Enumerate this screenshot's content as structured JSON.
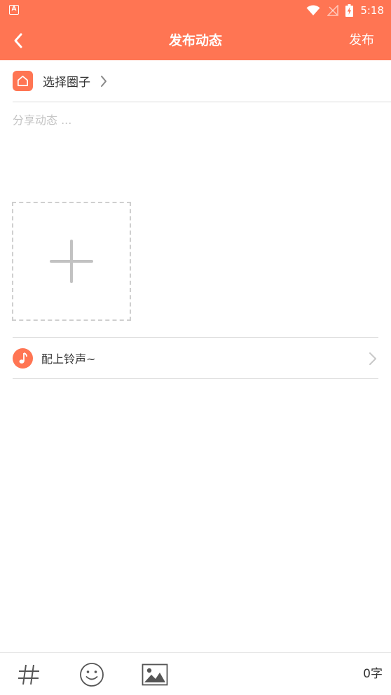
{
  "status_bar": {
    "app_badge": "A",
    "time": "5:18",
    "icons": [
      "wifi-icon",
      "no-signal-icon",
      "battery-charging-icon"
    ]
  },
  "app_bar": {
    "title": "发布动态",
    "publish_label": "发布",
    "back_icon": "chevron-left-icon"
  },
  "circle": {
    "label": "选择圈子",
    "icon": "home-icon",
    "chevron": "chevron-right-icon"
  },
  "post": {
    "placeholder": "分享动态 ...",
    "value": ""
  },
  "image_picker": {
    "icon": "plus-icon"
  },
  "ringtone": {
    "label": "配上铃声~",
    "icon": "music-note-icon"
  },
  "toolbar": {
    "tools": [
      "hashtag-icon",
      "emoji-icon",
      "image-icon"
    ],
    "char_count": "0字"
  },
  "colors": {
    "accent": "#ff7553",
    "divider": "#dcdcdc",
    "placeholder": "#c4c4c4"
  }
}
